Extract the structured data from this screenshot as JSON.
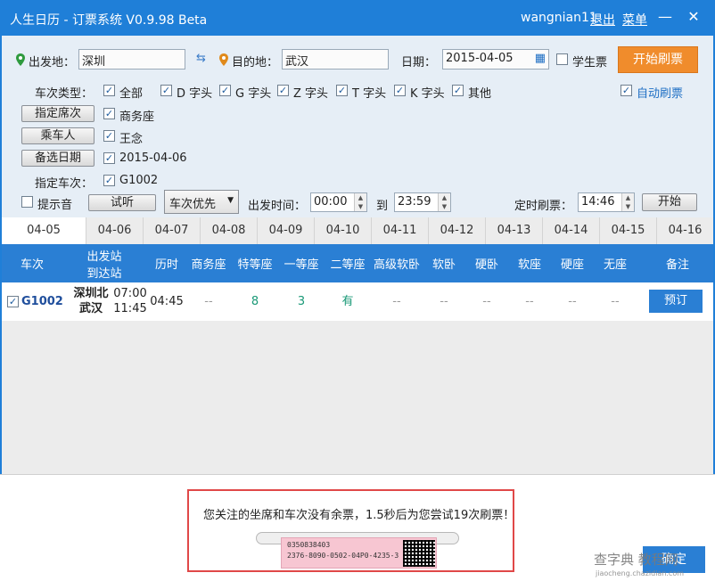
{
  "titlebar": {
    "app_title": "人生日历 - 订票系统 V0.9.98 Beta",
    "username": "wangnian11",
    "logout": "退出",
    "menu": "菜单",
    "minimize": "—",
    "close": "✕"
  },
  "form": {
    "from_label": "出发地：",
    "from_value": "深圳",
    "to_label": "目的地：",
    "to_value": "武汉",
    "date_label": "日期：",
    "date_value": "2015-04-05",
    "student_label": "学生票",
    "start_label": "开始刷票",
    "train_type_label": "车次类型：",
    "train_types": [
      "全部",
      "D 字头",
      "G 字头",
      "Z 字头",
      "T 字头",
      "K 字头",
      "其他"
    ],
    "auto_refresh": "自动刷票",
    "seat_btn": "指定席次",
    "seat_value": "商务座",
    "passenger_btn": "乘车人",
    "passenger_value": "王念",
    "alt_date_btn": "备选日期",
    "alt_date_value": "2015-04-06",
    "train_label": "指定车次：",
    "train_value": "G1002",
    "sound_label": "提示音",
    "try_listen": "试听",
    "priority_value": "车次优先",
    "depart_time_label": "出发时间：",
    "time_from": "00:00",
    "time_to_label": "到",
    "time_to": "23:59",
    "timer_label": "定时刷票：",
    "timer_value": "14:46",
    "timer_start": "开始"
  },
  "tabs": [
    "04-05",
    "04-06",
    "04-07",
    "04-08",
    "04-09",
    "04-10",
    "04-11",
    "04-12",
    "04-13",
    "04-14",
    "04-15",
    "04-16"
  ],
  "table": {
    "headers": {
      "train": "车次",
      "station_top": "出发站",
      "station_bottom": "到达站",
      "duration": "历时",
      "business": "商务座",
      "premium": "特等座",
      "first": "一等座",
      "second": "二等座",
      "soft_deluxe": "高级软卧",
      "soft_sleeper": "软卧",
      "hard_sleeper": "硬卧",
      "soft_seat": "软座",
      "hard_seat": "硬座",
      "standing": "无座",
      "note": "备注"
    },
    "rows": [
      {
        "train": "G1002",
        "from_station": "深圳北",
        "to_station": "武汉",
        "depart": "07:00",
        "arrive": "11:45",
        "duration": "04:45",
        "business": "--",
        "premium": "8",
        "first": "3",
        "second": "有",
        "soft_deluxe": "--",
        "soft_sleeper": "--",
        "hard_sleeper": "--",
        "soft_seat": "--",
        "hard_seat": "--",
        "standing": "--",
        "book": "预订"
      }
    ]
  },
  "notice": {
    "message": "您关注的坐席和车次没有余票，1.5秒后为您尝试19次刷票！",
    "ticket_line1": "0350838403",
    "ticket_line2": "2376-8090-0502-04P0-4235-3"
  },
  "bottom": {
    "ok_btn": "确定",
    "watermark": "查字典 教程网",
    "watermark_url": "jiaocheng.chazidian.com"
  },
  "colors": {
    "title_blue": "#1f7fd8",
    "header_blue": "#2a7fd4",
    "accent_orange": "#f08c2c",
    "available_green": "#1a9977",
    "alert_red": "#e04848"
  }
}
